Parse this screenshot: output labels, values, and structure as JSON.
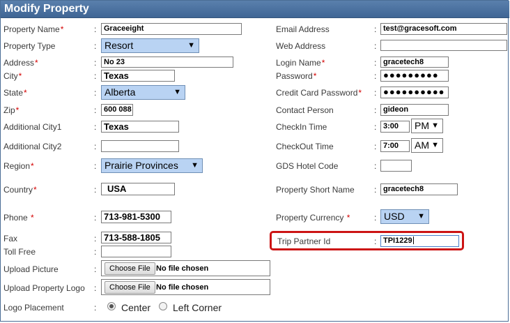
{
  "title": "Modify Property",
  "required_marker": "*",
  "colon": ":",
  "left": {
    "property_name": {
      "label": "Property Name",
      "value": "Graceeight"
    },
    "property_type": {
      "label": "Property Type",
      "value": "Resort"
    },
    "address": {
      "label": "Address",
      "value": "No 23"
    },
    "city": {
      "label": "City",
      "value": "Texas"
    },
    "state": {
      "label": "State",
      "value": "Alberta"
    },
    "zip": {
      "label": "Zip",
      "value": "600 088"
    },
    "additional_city1": {
      "label": "Additional City1",
      "value": "Texas"
    },
    "additional_city2": {
      "label": "Additional City2",
      "value": ""
    },
    "region": {
      "label": "Region",
      "value": "Prairie Provinces"
    },
    "country": {
      "label": "Country",
      "value": "USA"
    },
    "phone": {
      "label": "Phone",
      "value": "713-981-5300"
    },
    "fax": {
      "label": "Fax",
      "value": "713-588-1805"
    },
    "toll_free": {
      "label": "Toll Free",
      "value": ""
    },
    "upload_picture": {
      "label": "Upload Picture",
      "button": "Choose File",
      "status": "No file chosen"
    },
    "upload_logo": {
      "label": "Upload Property Logo",
      "button": "Choose File",
      "status": "No file chosen"
    },
    "logo_placement": {
      "label": "Logo Placement",
      "option_center": "Center",
      "option_left": "Left Corner"
    }
  },
  "right": {
    "email": {
      "label": "Email Address",
      "value": "test@gracesoft.com"
    },
    "web": {
      "label": "Web Address",
      "value": ""
    },
    "login": {
      "label": "Login Name",
      "value": "gracetech8"
    },
    "password": {
      "label": "Password",
      "value": "●●●●●●●●●"
    },
    "cc_password": {
      "label": "Credit Card Password",
      "value": "●●●●●●●●●●"
    },
    "contact": {
      "label": "Contact Person",
      "value": "gideon"
    },
    "checkin": {
      "label": "CheckIn Time",
      "time": "3:00",
      "ampm": "PM"
    },
    "checkout": {
      "label": "CheckOut Time",
      "time": "7:00",
      "ampm": "AM"
    },
    "gds": {
      "label": "GDS Hotel Code",
      "value": ""
    },
    "short_name": {
      "label": "Property Short Name",
      "value": "gracetech8"
    },
    "currency": {
      "label": "Property Currency",
      "value": "USD"
    },
    "trip_partner": {
      "label": "Trip Partner Id",
      "value": "TPI1229"
    }
  },
  "icons": {
    "dropdown": "▼"
  }
}
